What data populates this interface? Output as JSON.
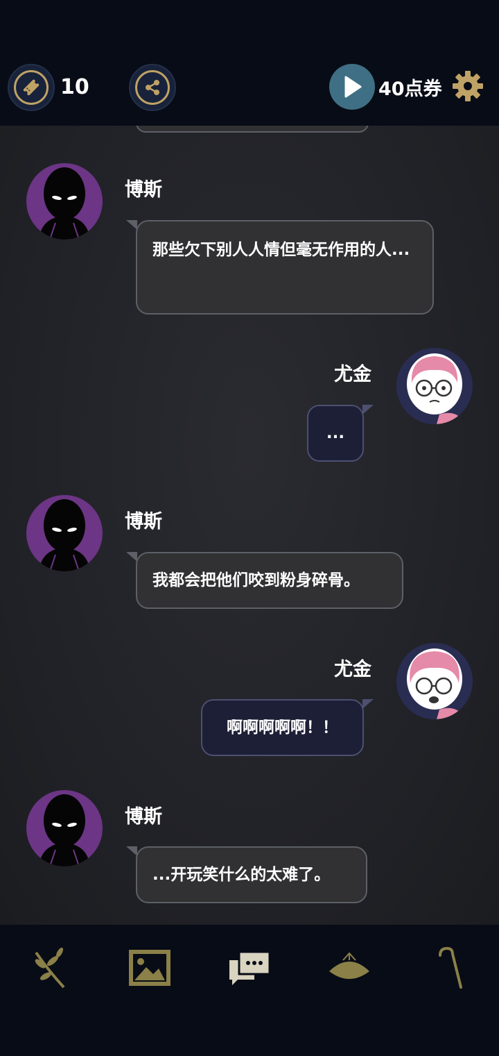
{
  "header": {
    "ticket_count": "10",
    "points_label": "40点券"
  },
  "messages": [
    {
      "speaker": "博斯",
      "side": "left",
      "text": "那些欠下别人人情但毫无作用的人..."
    },
    {
      "speaker": "尤金",
      "side": "right",
      "text": "..."
    },
    {
      "speaker": "博斯",
      "side": "left",
      "text": "我都会把他们咬到粉身碎骨。"
    },
    {
      "speaker": "尤金",
      "side": "right",
      "text": "啊啊啊啊啊！！"
    },
    {
      "speaker": "博斯",
      "side": "left",
      "text": "...开玩笑什么的太难了。"
    }
  ],
  "bottom_nav": [
    {
      "icon": "branch-icon"
    },
    {
      "icon": "gallery-icon"
    },
    {
      "icon": "chat-icon"
    },
    {
      "icon": "hat-icon"
    },
    {
      "icon": "cane-icon"
    }
  ],
  "colors": {
    "gold": "#bfa265",
    "bar_bg": "#080c16",
    "play_teal": "#3f6f84"
  }
}
